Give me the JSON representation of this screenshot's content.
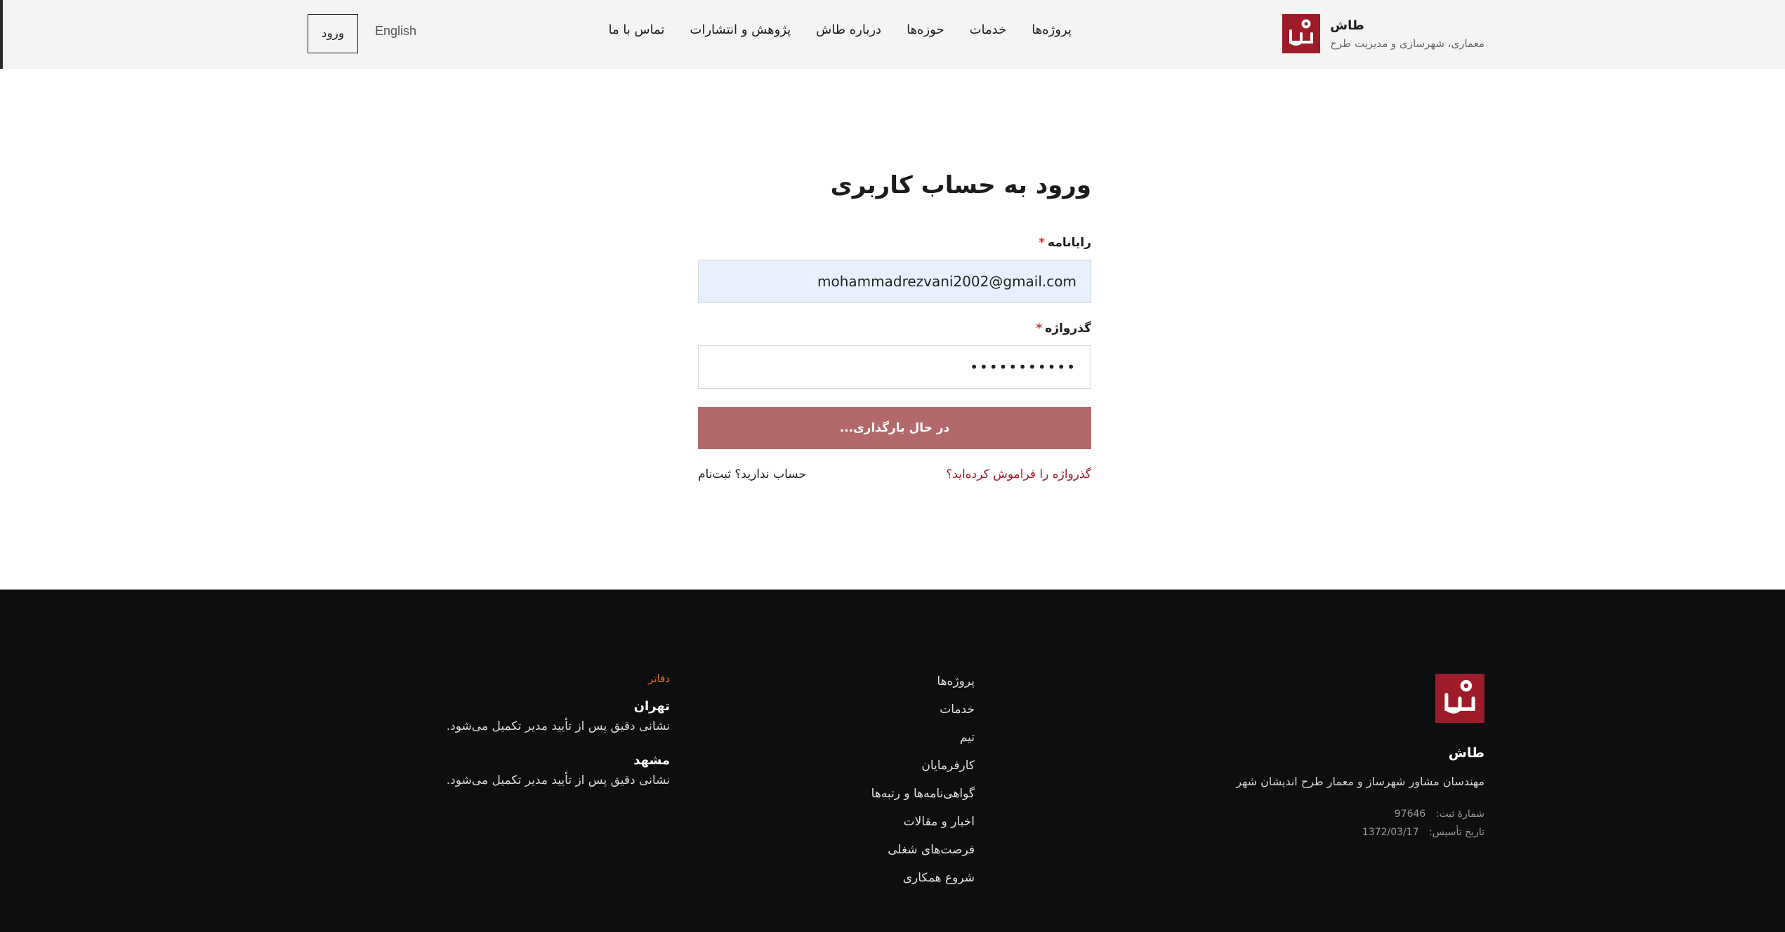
{
  "header": {
    "brand_name": "طاش",
    "brand_tagline": "معماری، شهرسازی و مدیریت طرح",
    "nav": [
      "پروژه‌ها",
      "خدمات",
      "حوزه‌ها",
      "درباره طاش",
      "پژوهش و انتشارات",
      "تماس با ما"
    ],
    "language_link": "English",
    "login_button": "ورود"
  },
  "form": {
    "title": "ورود به حساب کاربری",
    "email_label": "رایانامه",
    "email_value": "mohammadrezvani2002@gmail.com",
    "password_label": "گذرواژه",
    "password_value": "•••••••••••",
    "required_mark": "*",
    "submit_label": "در حال بارگذاری...",
    "forgot_link": "گذرواژه را فراموش کرده‌اید؟",
    "signup_link": "حساب ندارید؟ ثبت‌نام"
  },
  "footer": {
    "brand_name": "طاش",
    "brand_description": "مهندسان مشاور شهرساز و معمار طرح اندیشان شهر",
    "registration_label": "شمارهٔ ثبت:",
    "registration_number": "97646",
    "founded_label": "تاریخ تأسیس:",
    "founded_date": "1372/03/17",
    "links": [
      "پروژه‌ها",
      "خدمات",
      "تیم",
      "کارفرمایان",
      "گواهی‌نامه‌ها و رتبه‌ها",
      "اخبار و مقالات",
      "فرصت‌های شغلی",
      "شروع همکاری"
    ],
    "offices_title": "دفاتر",
    "offices": [
      {
        "city": "تهران",
        "address": "نشانی دقیق پس از تأیید مدیر تکمیل می‌شود."
      },
      {
        "city": "مشهد",
        "address": "نشانی دقیق پس از تأیید مدیر تکمیل می‌شود."
      }
    ]
  },
  "colors": {
    "brand": "#9e1c2a",
    "header_bg": "#f5f4f2",
    "email_input_bg": "#e8f0fd",
    "submit_bg": "#b3696c",
    "footer_bg": "#0d0e10",
    "offices_title": "#e0712e"
  },
  "icons": {
    "logo": "tash-logo"
  }
}
